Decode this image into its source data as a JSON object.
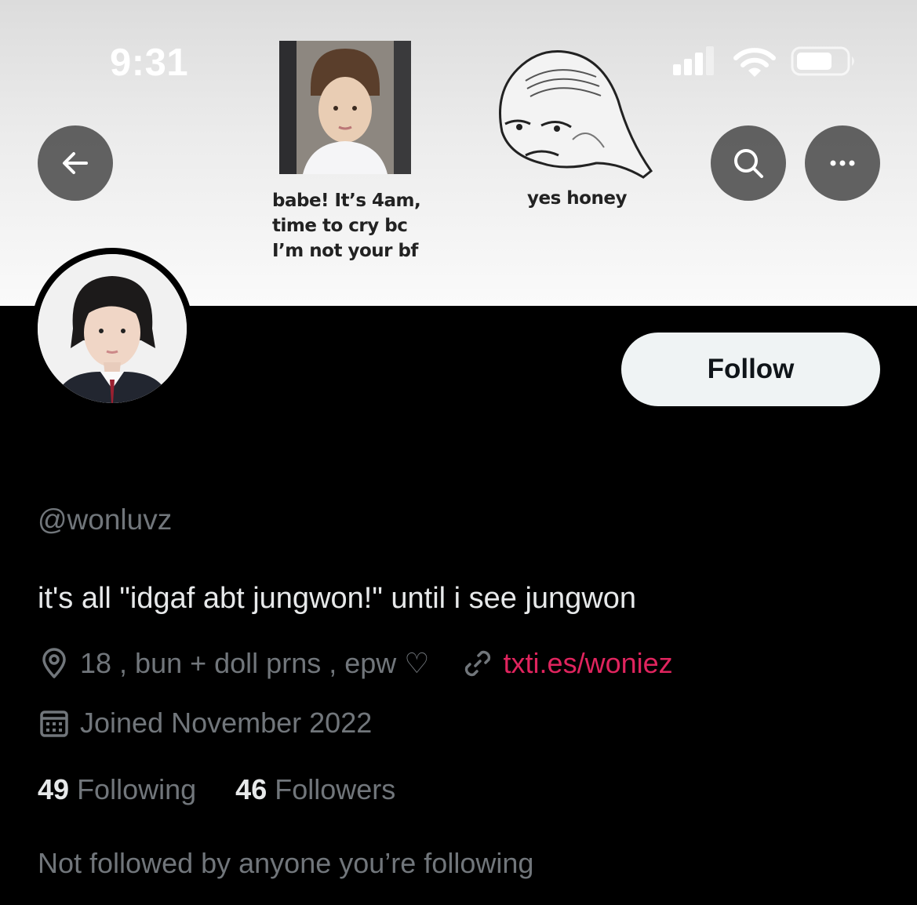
{
  "status_bar": {
    "time": "9:31",
    "icons": [
      "cellular-signal-icon",
      "wifi-icon",
      "battery-icon"
    ]
  },
  "banner": {
    "caption_left": [
      "babe! It’s 4am,",
      "time to cry bc",
      "I’m not your bf"
    ],
    "caption_right": "yes honey"
  },
  "nav": {
    "back_icon": "arrow-left-icon",
    "search_icon": "search-icon",
    "more_icon": "more-horizontal-icon"
  },
  "profile": {
    "follow_label": "Follow",
    "handle": "@wonluvz",
    "bio": "it's all \"idgaf abt jungwon!\" until i see jungwon",
    "location": "18 , bun + doll prns , epw ♡",
    "website": "txti.es/woniez",
    "joined": "Joined November 2022",
    "following_count": "49",
    "following_label": "Following",
    "followers_count": "46",
    "followers_label": "Followers",
    "followed_by_note": "Not followed by anyone you’re following"
  },
  "colors": {
    "background": "#000000",
    "primary_text": "#e7e9ea",
    "secondary_text": "#71767b",
    "link": "#e0245e",
    "follow_button_bg": "#eff3f4"
  }
}
